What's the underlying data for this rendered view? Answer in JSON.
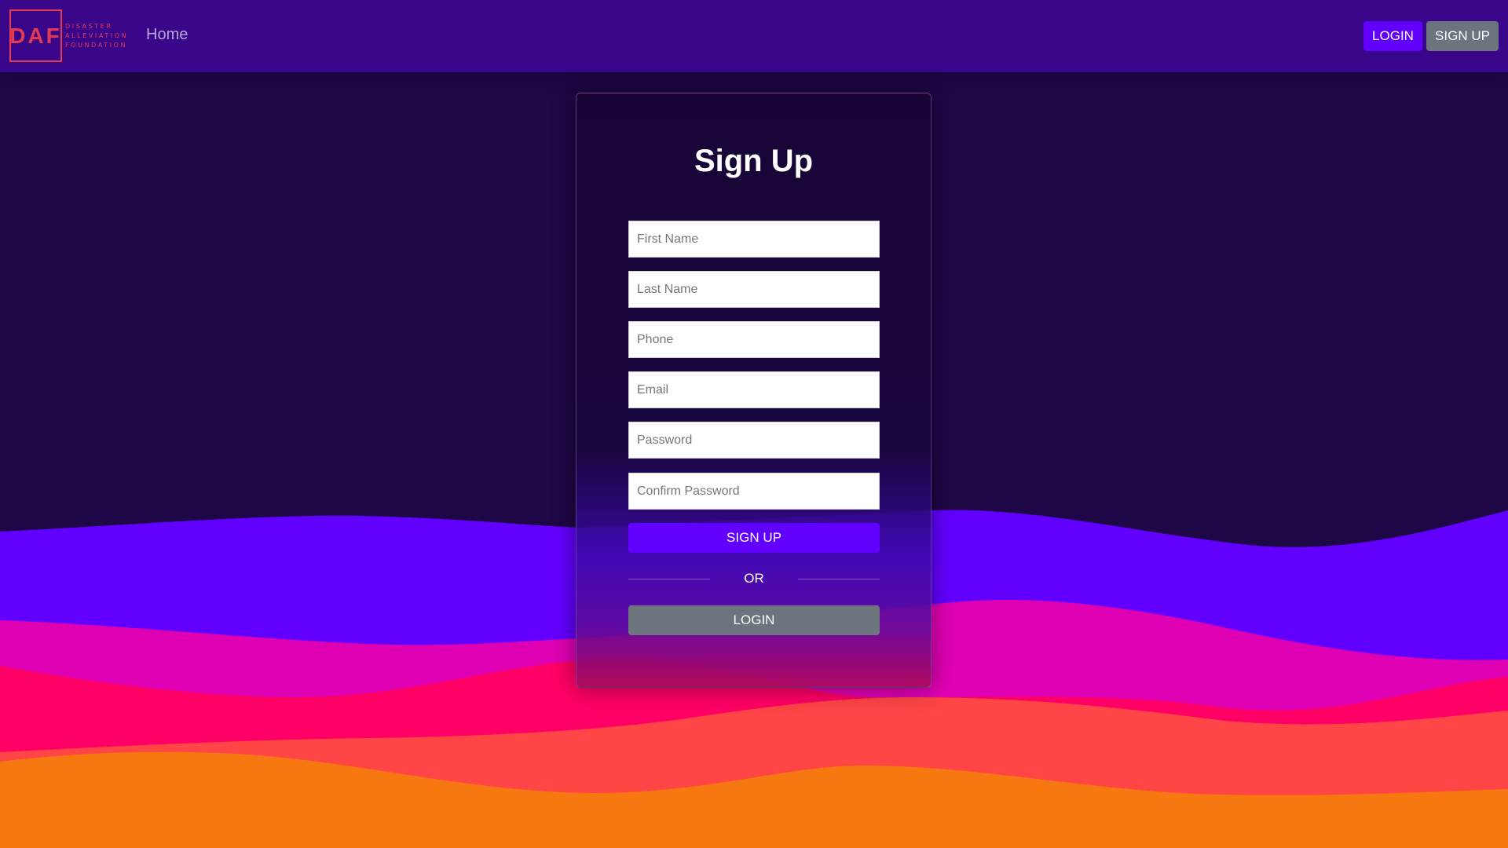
{
  "brand": {
    "logo_letters": "DAF",
    "logo_lines": [
      "DISASTER",
      "ALLEVIATION",
      "FOUNDATION"
    ]
  },
  "nav": {
    "home_label": "Home",
    "login_label": "LOGIN",
    "signup_label": "SIGN UP"
  },
  "form": {
    "title": "Sign Up",
    "fields": {
      "first_name": {
        "placeholder": "First Name",
        "value": ""
      },
      "last_name": {
        "placeholder": "Last Name",
        "value": ""
      },
      "phone": {
        "placeholder": "Phone",
        "value": ""
      },
      "email": {
        "placeholder": "Email",
        "value": ""
      },
      "password": {
        "placeholder": "Password",
        "value": ""
      },
      "confirm_password": {
        "placeholder": "Confirm Password",
        "value": ""
      }
    },
    "signup_button": "SIGN UP",
    "divider_text": "OR",
    "login_button": "LOGIN"
  },
  "colors": {
    "navbar": "#3a0689",
    "background": "#1d0746",
    "primary": "#6200ff",
    "secondary": "#6c757d",
    "logo": "#e33a55",
    "wave_purple": "#6200ff",
    "wave_magenta": "#e000b4",
    "wave_pink": "#ff0066",
    "wave_coral": "#ff4545",
    "wave_orange": "#f77811"
  }
}
